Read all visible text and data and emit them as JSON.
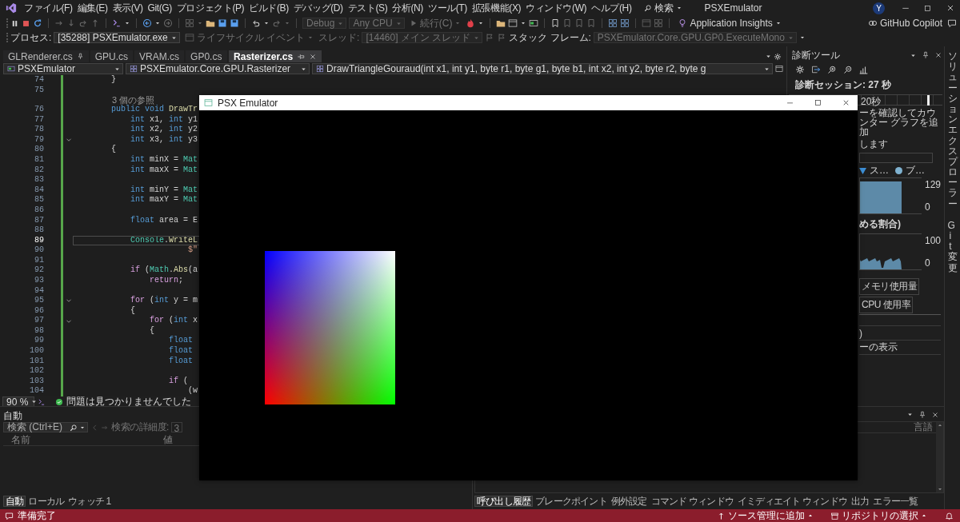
{
  "title_bar": {
    "menu": [
      "ファイル(F)",
      "編集(E)",
      "表示(V)",
      "Git(G)",
      "プロジェクト(P)",
      "ビルド(B)",
      "デバッグ(D)",
      "テスト(S)",
      "分析(N)",
      "ツール(T)",
      "拡張機能(X)",
      "ウィンドウ(W)",
      "ヘルプ(H)"
    ],
    "search": "検索",
    "title": "PSXEmulator",
    "avatar": "Y"
  },
  "debug_toolbar": {
    "configuration": {
      "text": "Debug",
      "disabled": true
    },
    "platform": {
      "text": "Any CPU",
      "disabled": true
    },
    "continue": {
      "text": "続行(C)",
      "disabled": true
    },
    "insights": "Application Insights",
    "copilot": "GitHub Copilot"
  },
  "location_toolbar": {
    "process_label": {
      "text": "プロセス:",
      "disabled": false
    },
    "process": {
      "text": "[35288] PSXEmulator.exe",
      "disabled": false
    },
    "lifecycle": {
      "text": "ライフサイクル イベント",
      "disabled": true
    },
    "thread_label": {
      "text": "スレッド:",
      "disabled": true
    },
    "thread": {
      "text": "[14460] メイン スレッド",
      "disabled": true
    },
    "stack_label": {
      "text": "スタック フレーム:",
      "disabled": false
    },
    "stack_frame": {
      "text": "PSXEmulator.Core.GPU.GP0.ExecuteMono",
      "disabled": true
    }
  },
  "editor": {
    "tabs": [
      {
        "label": "GLRenderer.cs",
        "selected": false,
        "pinned": true
      },
      {
        "label": "GPU.cs",
        "selected": false,
        "pinned": false
      },
      {
        "label": "VRAM.cs",
        "selected": false,
        "pinned": false
      },
      {
        "label": "GP0.cs",
        "selected": false,
        "pinned": false
      },
      {
        "label": "Rasterizer.cs",
        "selected": true,
        "pinned": false
      }
    ],
    "nav": [
      "PSXEmulator",
      "PSXEmulator.Core.GPU.Rasterizer",
      "DrawTriangleGouraud(int x1, int y1, byte r1, byte g1, byte b1, int x2, int y2, byte r2, byte g"
    ],
    "lines": [
      {
        "kind": "code",
        "number": "74",
        "current": false,
        "folding": false,
        "tokens": [
          {
            "text": "        }",
            "kind": "plain"
          }
        ]
      },
      {
        "kind": "code",
        "number": "75",
        "current": false,
        "folding": false
      },
      {
        "kind": "codelens",
        "text": "3 個の参照"
      },
      {
        "kind": "code",
        "number": "76",
        "current": false,
        "folding": false,
        "tokens": [
          {
            "text": "        public void",
            "kind": "kw"
          },
          {
            "text": " DrawTr",
            "kind": "method"
          }
        ]
      },
      {
        "kind": "code",
        "number": "77",
        "current": false,
        "folding": false,
        "tokens": [
          {
            "text": "            int",
            "kind": "kw"
          },
          {
            "text": " x1, ",
            "kind": "plain"
          },
          {
            "text": "int",
            "kind": "kw"
          },
          {
            "text": " y1",
            "kind": "plain"
          }
        ]
      },
      {
        "kind": "code",
        "number": "78",
        "current": false,
        "folding": false,
        "tokens": [
          {
            "text": "            int",
            "kind": "kw"
          },
          {
            "text": " x2, ",
            "kind": "plain"
          },
          {
            "text": "int",
            "kind": "kw"
          },
          {
            "text": " y2",
            "kind": "plain"
          }
        ]
      },
      {
        "kind": "code",
        "number": "79",
        "current": false,
        "folding": true,
        "tokens": [
          {
            "text": "            int",
            "kind": "kw"
          },
          {
            "text": " x3, ",
            "kind": "plain"
          },
          {
            "text": "int",
            "kind": "kw"
          },
          {
            "text": " y3",
            "kind": "plain"
          }
        ]
      },
      {
        "kind": "code",
        "number": "80",
        "current": false,
        "folding": false,
        "tokens": [
          {
            "text": "        {",
            "kind": "plain"
          }
        ]
      },
      {
        "kind": "code",
        "number": "81",
        "current": false,
        "folding": false,
        "tokens": [
          {
            "text": "            int",
            "kind": "kw"
          },
          {
            "text": " minX = ",
            "kind": "plain"
          },
          {
            "text": "Mat",
            "kind": "type"
          }
        ]
      },
      {
        "kind": "code",
        "number": "82",
        "current": false,
        "folding": false,
        "tokens": [
          {
            "text": "            int",
            "kind": "kw"
          },
          {
            "text": " maxX = ",
            "kind": "plain"
          },
          {
            "text": "Mat",
            "kind": "type"
          }
        ]
      },
      {
        "kind": "code",
        "number": "83",
        "current": false,
        "folding": false
      },
      {
        "kind": "code",
        "number": "84",
        "current": false,
        "folding": false,
        "tokens": [
          {
            "text": "            int",
            "kind": "kw"
          },
          {
            "text": " minY = ",
            "kind": "plain"
          },
          {
            "text": "Mat",
            "kind": "type"
          }
        ]
      },
      {
        "kind": "code",
        "number": "85",
        "current": false,
        "folding": false,
        "tokens": [
          {
            "text": "            int",
            "kind": "kw"
          },
          {
            "text": " maxY = ",
            "kind": "plain"
          },
          {
            "text": "Mat",
            "kind": "type"
          }
        ]
      },
      {
        "kind": "code",
        "number": "86",
        "current": false,
        "folding": false
      },
      {
        "kind": "code",
        "number": "87",
        "current": false,
        "folding": false,
        "tokens": [
          {
            "text": "            float",
            "kind": "kw"
          },
          {
            "text": " area = E",
            "kind": "plain"
          }
        ]
      },
      {
        "kind": "code",
        "number": "88",
        "current": false,
        "folding": false
      },
      {
        "kind": "code",
        "number": "89",
        "current": true,
        "folding": false,
        "tokens": [
          {
            "text": "            Console",
            "kind": "type"
          },
          {
            "text": ".",
            "kind": "plain"
          },
          {
            "text": "WriteL",
            "kind": "method"
          }
        ]
      },
      {
        "kind": "code",
        "number": "90",
        "current": false,
        "folding": false,
        "tokens": [
          {
            "text": "                        $\"",
            "kind": "string"
          }
        ]
      },
      {
        "kind": "code",
        "number": "91",
        "current": false,
        "folding": false
      },
      {
        "kind": "code",
        "number": "92",
        "current": false,
        "folding": false,
        "tokens": [
          {
            "text": "            if",
            "kind": "ctrl"
          },
          {
            "text": " (",
            "kind": "plain"
          },
          {
            "text": "Math",
            "kind": "type"
          },
          {
            "text": ".",
            "kind": "plain"
          },
          {
            "text": "Abs",
            "kind": "method"
          },
          {
            "text": "(a",
            "kind": "plain"
          }
        ]
      },
      {
        "kind": "code",
        "number": "93",
        "current": false,
        "folding": false,
        "tokens": [
          {
            "text": "                return",
            "kind": "ctrl"
          },
          {
            "text": ";",
            "kind": "plain"
          }
        ]
      },
      {
        "kind": "code",
        "number": "94",
        "current": false,
        "folding": false
      },
      {
        "kind": "code",
        "number": "95",
        "current": false,
        "folding": true,
        "tokens": [
          {
            "text": "            for",
            "kind": "ctrl"
          },
          {
            "text": " (",
            "kind": "plain"
          },
          {
            "text": "int",
            "kind": "kw"
          },
          {
            "text": " y = m",
            "kind": "plain"
          }
        ]
      },
      {
        "kind": "code",
        "number": "96",
        "current": false,
        "folding": false,
        "tokens": [
          {
            "text": "            {",
            "kind": "plain"
          }
        ]
      },
      {
        "kind": "code",
        "number": "97",
        "current": false,
        "folding": true,
        "tokens": [
          {
            "text": "                for",
            "kind": "ctrl"
          },
          {
            "text": " (",
            "kind": "plain"
          },
          {
            "text": "int",
            "kind": "kw"
          },
          {
            "text": " x",
            "kind": "plain"
          }
        ]
      },
      {
        "kind": "code",
        "number": "98",
        "current": false,
        "folding": false,
        "tokens": [
          {
            "text": "                {",
            "kind": "plain"
          }
        ]
      },
      {
        "kind": "code",
        "number": "99",
        "current": false,
        "folding": false,
        "tokens": [
          {
            "text": "                    float",
            "kind": "kw"
          }
        ]
      },
      {
        "kind": "code",
        "number": "100",
        "current": false,
        "folding": false,
        "tokens": [
          {
            "text": "                    float",
            "kind": "kw"
          }
        ]
      },
      {
        "kind": "code",
        "number": "101",
        "current": false,
        "folding": false,
        "tokens": [
          {
            "text": "                    float",
            "kind": "kw"
          }
        ]
      },
      {
        "kind": "code",
        "number": "102",
        "current": false,
        "folding": false
      },
      {
        "kind": "code",
        "number": "103",
        "current": false,
        "folding": false,
        "tokens": [
          {
            "text": "                    if",
            "kind": "ctrl"
          },
          {
            "text": " (",
            "kind": "plain"
          }
        ]
      },
      {
        "kind": "code",
        "number": "104",
        "current": false,
        "folding": false,
        "tokens": [
          {
            "text": "                        (w",
            "kind": "plain"
          }
        ]
      }
    ],
    "zoom": "90 %",
    "issues": "問題は見つかりませんでした"
  },
  "diagnostics": {
    "title": "診断ツール",
    "session": "診断セッション: 27 秒",
    "timeline_label": "20秒",
    "hint": [
      "ーを確認してカウンター グラフを追加",
      "します"
    ],
    "legend": [
      {
        "label": "ス…",
        "kind": "triangle",
        "color": "#3d8fd6"
      },
      {
        "label": "ブ…",
        "kind": "circle",
        "color": "#7fb2d0"
      }
    ],
    "memory_axis": [
      "129",
      "0"
    ],
    "cpu_title": "める割合)",
    "cpu_axis": [
      "100",
      "0"
    ],
    "tabs": [
      {
        "label": "メモリ使用量",
        "selected": false
      },
      {
        "label": "CPU 使用率",
        "selected": false
      }
    ],
    "rows": [
      ")",
      "ーの表示"
    ]
  },
  "side_tabs": [
    "ソリューションエクスプローラー",
    "Git 変更"
  ],
  "autos": {
    "title": "自動",
    "search_placeholder": "検索 (Ctrl+E)",
    "depth_label": "検索の詳細度:",
    "depth": "3",
    "columns": [
      "名前",
      "値"
    ],
    "tabs": [
      {
        "label": "自動",
        "selected": true
      },
      {
        "label": "ローカル",
        "selected": false
      },
      {
        "label": "ウォッチ 1",
        "selected": false
      }
    ]
  },
  "call_stack": {
    "columns": [
      "言語"
    ],
    "tabs": [
      {
        "label": "呼び出し履歴",
        "selected": true
      },
      {
        "label": "ブレークポイント",
        "selected": false
      },
      {
        "label": "例外設定",
        "selected": false
      },
      {
        "label": "コマンド ウィンドウ",
        "selected": false
      },
      {
        "label": "イミディエイト ウィンドウ",
        "selected": false
      },
      {
        "label": "出力",
        "selected": false
      },
      {
        "label": "エラー一覧",
        "selected": false
      }
    ]
  },
  "status_bar": {
    "message": "準備完了",
    "source_control": "ソース管理に追加",
    "repository": "リポジトリの選択"
  },
  "emulator": {
    "title": "PSX Emulator"
  }
}
